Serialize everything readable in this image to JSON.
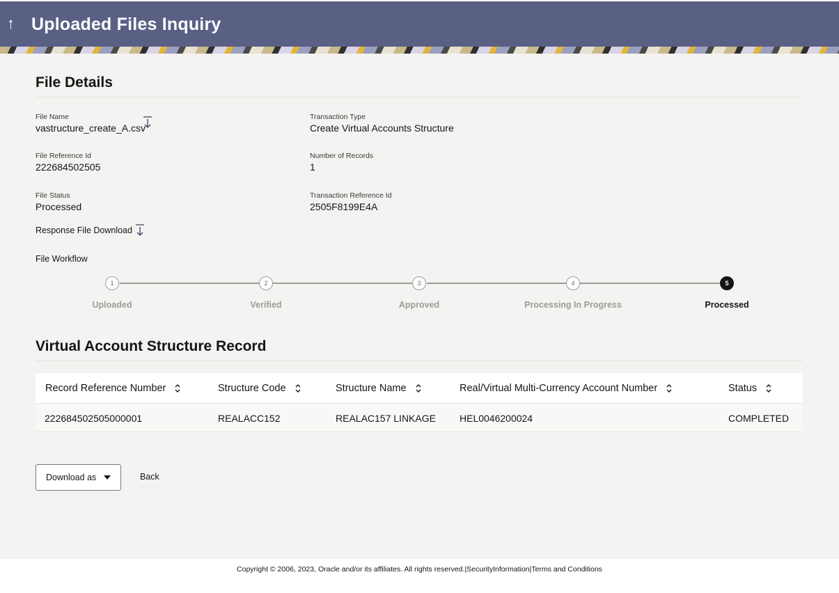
{
  "header": {
    "title": "Uploaded Files Inquiry",
    "back_icon": "↑"
  },
  "file_details": {
    "section_title": "File Details",
    "file_name_label": "File Name",
    "file_name": "vastructure_create_A.csv",
    "transaction_type_label": "Transaction Type",
    "transaction_type": "Create Virtual Accounts Structure",
    "file_reference_label": "File Reference Id",
    "file_reference": "222684502505",
    "number_of_records_label": "Number of Records",
    "number_of_records": "1",
    "file_status_label": "File Status",
    "file_status": "Processed",
    "transaction_reference_label": "Transaction Reference Id",
    "transaction_reference": "2505F8199E4A",
    "response_download_label": "Response File Download",
    "workflow_label": "File Workflow"
  },
  "workflow": {
    "steps": [
      {
        "number": "1",
        "label": "Uploaded",
        "active": false
      },
      {
        "number": "2",
        "label": "Verified",
        "active": false
      },
      {
        "number": "3",
        "label": "Approved",
        "active": false
      },
      {
        "number": "4",
        "label": "Processing In Progress",
        "active": false
      },
      {
        "number": "5",
        "label": "Processed",
        "active": true
      }
    ]
  },
  "records": {
    "section_title": "Virtual Account Structure Record",
    "columns": [
      "Record Reference Number",
      "Structure Code",
      "Structure Name",
      "Real/Virtual Multi-Currency Account Number",
      "Status"
    ],
    "rows": [
      [
        "222684502505000001",
        "REALACC152",
        "REALAC157 LINKAGE",
        "HEL0046200024",
        "COMPLETED"
      ]
    ]
  },
  "actions": {
    "download_label": "Download as",
    "back_label": "Back"
  },
  "footer": {
    "copyright": "Copyright © 2006, 2023, Oracle and/or its affiliates. All rights reserved.",
    "security_link": "SecurityInformation",
    "terms_link": "Terms and Conditions",
    "separator": "|"
  },
  "colors": {
    "header_bg": "#5a6084",
    "page_bg": "#f4f3f1",
    "active_step": "#161513",
    "inactive_step": "#9e9c98"
  }
}
